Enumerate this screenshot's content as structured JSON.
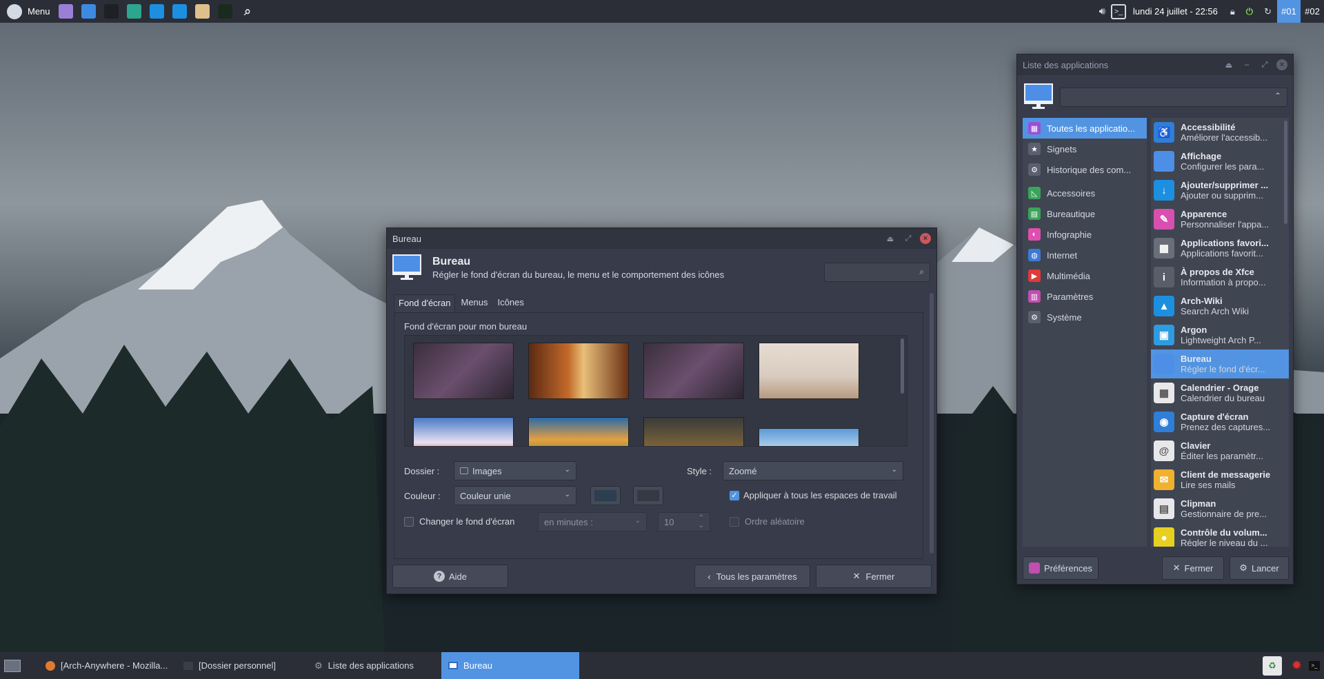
{
  "top_panel": {
    "menu_label": "Menu",
    "launchers": [
      {
        "icon": "file-manager-icon",
        "color": "#9b7fd6"
      },
      {
        "icon": "window-manager-icon",
        "color": "#3d8be0"
      },
      {
        "icon": "terminal-icon",
        "color": "#1e2024"
      },
      {
        "icon": "network-icon",
        "color": "#2ea58f"
      },
      {
        "icon": "arch-wiki-icon",
        "color": "#1d8fe0"
      },
      {
        "icon": "download-icon",
        "color": "#1d8fe0"
      },
      {
        "icon": "archive-icon",
        "color": "#e0c08a"
      },
      {
        "icon": "task-manager-icon",
        "color": "#1b2a1e"
      },
      {
        "icon": "search-icon",
        "color": "transparent"
      }
    ],
    "clock": "lundi 24 juillet - 22:56",
    "workspaces": [
      "#01",
      "#02"
    ]
  },
  "app_list_window": {
    "title": "Liste des applications",
    "categories": [
      {
        "label": "Toutes les applicatio...",
        "icon": "grid-icon",
        "color": "#9b4fd6"
      },
      {
        "label": "Signets",
        "icon": "star-icon",
        "color": "#5a6070"
      },
      {
        "label": "Historique des com...",
        "icon": "gears-icon",
        "color": "#5a6070"
      },
      {
        "label": "Accessoires",
        "icon": "ruler-icon",
        "color": "#3aa55a"
      },
      {
        "label": "Bureautique",
        "icon": "office-icon",
        "color": "#3aa55a"
      },
      {
        "label": "Infographie",
        "icon": "graphics-icon",
        "color": "#e04fb0"
      },
      {
        "label": "Internet",
        "icon": "globe-icon",
        "color": "#3d7ad6"
      },
      {
        "label": "Multimédia",
        "icon": "multimedia-icon",
        "color": "#e03a3a"
      },
      {
        "label": "Paramètres",
        "icon": "settings-icon",
        "color": "#c04fb0"
      },
      {
        "label": "Système",
        "icon": "system-gear-icon",
        "color": "#5a6070"
      }
    ],
    "apps": [
      {
        "name": "Accessibilité",
        "desc": "Améliorer l'accessib...",
        "icon": "accessibility-icon",
        "color": "#2f7ed8"
      },
      {
        "name": "Affichage",
        "desc": "Configurer les para...",
        "icon": "display-icon",
        "color": "#4d8fe6"
      },
      {
        "name": "Ajouter/supprimer ...",
        "desc": "Ajouter ou supprim...",
        "icon": "add-remove-icon",
        "color": "#1d8fe0"
      },
      {
        "name": "Apparence",
        "desc": "Personnaliser l'appa...",
        "icon": "appearance-icon",
        "color": "#d84fb0"
      },
      {
        "name": "Applications favori...",
        "desc": "Applications favorit...",
        "icon": "favorite-apps-icon",
        "color": "#6a6e78"
      },
      {
        "name": "À propos de Xfce",
        "desc": "Information à propo...",
        "icon": "info-icon",
        "color": "#5a5e68"
      },
      {
        "name": "Arch-Wiki",
        "desc": "Search Arch Wiki",
        "icon": "arch-icon",
        "color": "#1d8fe0"
      },
      {
        "name": "Argon",
        "desc": "Lightweight Arch P...",
        "icon": "package-icon",
        "color": "#2f9be0"
      },
      {
        "name": "Bureau",
        "desc": "Régler le fond d'écr...",
        "icon": "desktop-icon",
        "color": "#4d8fe6"
      },
      {
        "name": "Calendrier - Orage",
        "desc": "Calendrier du bureau",
        "icon": "calendar-icon",
        "color": "#e8e8ea"
      },
      {
        "name": "Capture d'écran",
        "desc": "Prenez des captures...",
        "icon": "screenshot-icon",
        "color": "#2f7ed8"
      },
      {
        "name": "Clavier",
        "desc": "Éditer les paramètr...",
        "icon": "keyboard-icon",
        "color": "#e8e8ea"
      },
      {
        "name": "Client de messagerie",
        "desc": "Lire ses mails",
        "icon": "mail-icon",
        "color": "#f0b030"
      },
      {
        "name": "Clipman",
        "desc": "Gestionnaire de pre...",
        "icon": "clipboard-icon",
        "color": "#e8e8ea"
      },
      {
        "name": "Contrôle du volum...",
        "desc": "Régler le niveau du ...",
        "icon": "volume-icon",
        "color": "#e8d020"
      }
    ],
    "preferences_label": "Préférences",
    "close_label": "Fermer",
    "launch_label": "Lancer"
  },
  "bureau_window": {
    "title": "Bureau",
    "heading": "Bureau",
    "subtitle": "Régler le fond d'écran du bureau, le menu et le comportement des icônes",
    "tabs": [
      "Fond d'écran",
      "Menus",
      "Icônes"
    ],
    "section_label": "Fond d'écran pour mon bureau",
    "folder_label": "Dossier :",
    "folder_value": "Images",
    "style_label": "Style :",
    "style_value": "Zoomé",
    "color_label": "Couleur :",
    "color_value": "Couleur unie",
    "apply_all_label": "Appliquer à tous les espaces de travail",
    "change_label": "Changer le fond d'écran",
    "interval_value": "en minutes :",
    "minutes_value": "10",
    "random_label": "Ordre aléatoire",
    "help_label": "Aide",
    "all_settings_label": "Tous les paramètres",
    "close_label": "Fermer"
  },
  "taskbar": {
    "tasks": [
      {
        "label": "[Arch-Anywhere - Mozilla...",
        "icon": "firefox-icon"
      },
      {
        "label": "[Dossier personnel]",
        "icon": "folder-icon"
      },
      {
        "label": "Liste des applications",
        "icon": "gears-icon"
      },
      {
        "label": "Bureau",
        "icon": "desktop-icon"
      }
    ]
  }
}
